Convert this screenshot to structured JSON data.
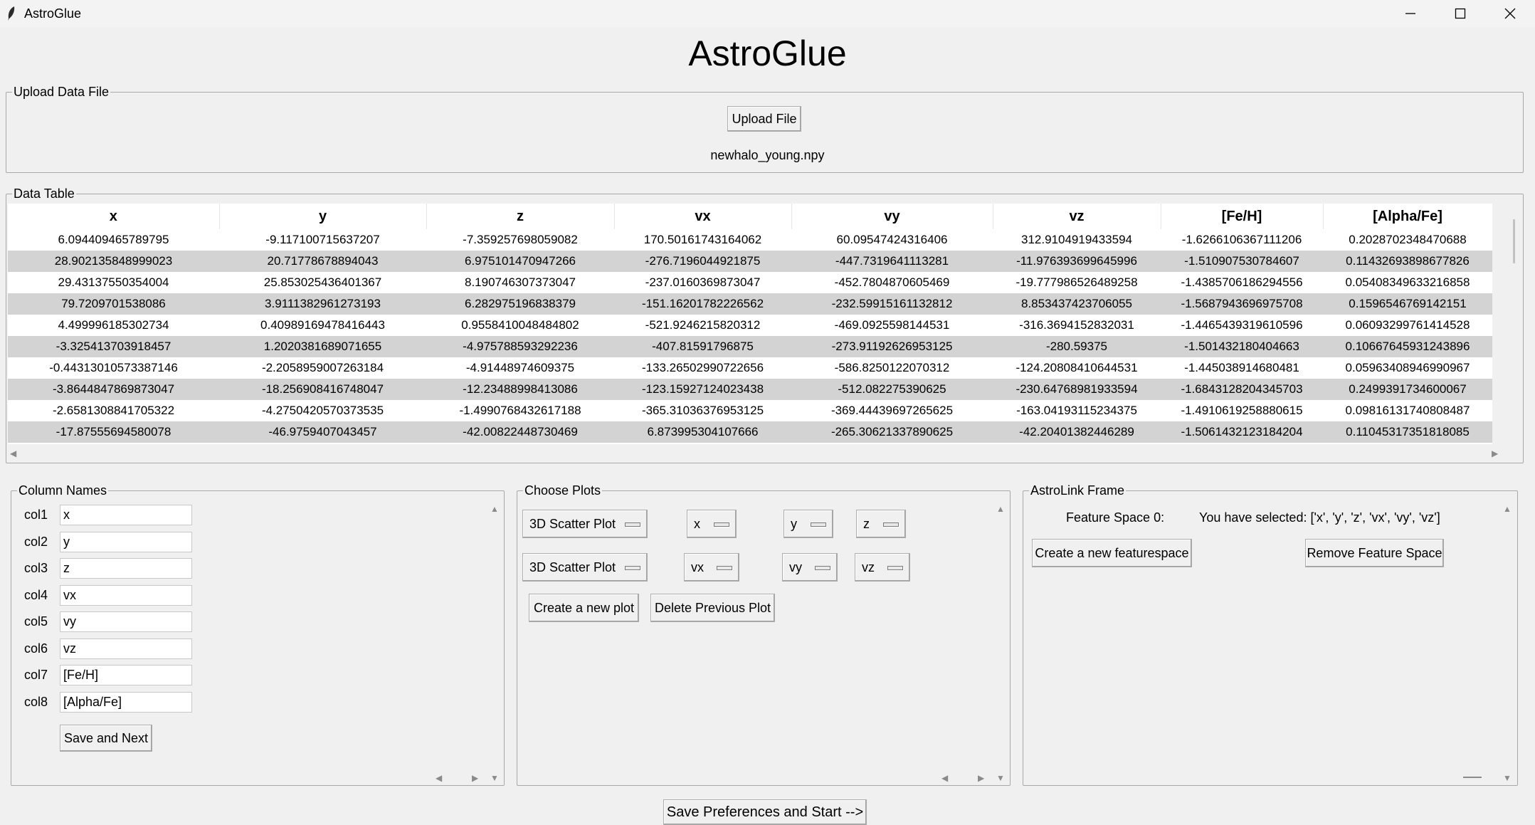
{
  "window": {
    "title": "AstroGlue",
    "minimize_icon": "minimize-icon",
    "maximize_icon": "maximize-icon",
    "close_icon": "close-icon"
  },
  "heading": "AstroGlue",
  "upload": {
    "legend": "Upload Data File",
    "button": "Upload File",
    "filename": "newhalo_young.npy"
  },
  "table": {
    "legend": "Data Table",
    "columns": [
      "x",
      "y",
      "z",
      "vx",
      "vy",
      "vz",
      "[Fe/H]",
      "[Alpha/Fe]"
    ],
    "rows": [
      [
        "6.094409465789795",
        "-9.117100715637207",
        "-7.359257698059082",
        "170.50161743164062",
        "60.09547424316406",
        "312.9104919433594",
        "-1.6266106367111206",
        "0.2028702348470688"
      ],
      [
        "28.902135848999023",
        "20.71778678894043",
        "6.975101470947266",
        "-276.7196044921875",
        "-447.7319641113281",
        "-11.976393699645996",
        "-1.510907530784607",
        "0.11432693898677826"
      ],
      [
        "29.43137550354004",
        "25.853025436401367",
        "8.190746307373047",
        "-237.0160369873047",
        "-452.7804870605469",
        "-19.777986526489258",
        "-1.4385706186294556",
        "0.05408349633216858"
      ],
      [
        "79.7209701538086",
        "3.9111382961273193",
        "6.282975196838379",
        "-151.16201782226562",
        "-232.59915161132812",
        "8.853437423706055",
        "-1.5687943696975708",
        "0.1596546769142151"
      ],
      [
        "4.499996185302734",
        "0.40989169478416443",
        "0.9558410048484802",
        "-521.9246215820312",
        "-469.0925598144531",
        "-316.3694152832031",
        "-1.4465439319610596",
        "0.06093299761414528"
      ],
      [
        "-3.325413703918457",
        "1.2020381689071655",
        "-4.975788593292236",
        "-407.81591796875",
        "-273.91192626953125",
        "-280.59375",
        "-1.501432180404663",
        "0.10667645931243896"
      ],
      [
        "-0.44313010573387146",
        "-2.2058959007263184",
        "-4.91448974609375",
        "-133.26502990722656",
        "-586.8250122070312",
        "-124.20808410644531",
        "-1.445038914680481",
        "0.05963408946990967"
      ],
      [
        "-3.8644847869873047",
        "-18.256908416748047",
        "-12.23488998413086",
        "-123.15927124023438",
        "-512.082275390625",
        "-230.64768981933594",
        "-1.6843128204345703",
        "0.2499391734600067"
      ],
      [
        "-2.6581308841705322",
        "-4.2750420570373535",
        "-1.4990768432617188",
        "-365.31036376953125",
        "-369.44439697265625",
        "-163.04193115234375",
        "-1.4910619258880615",
        "0.09816131740808487"
      ],
      [
        "-17.87555694580078",
        "-46.9759407043457",
        "-42.00822448730469",
        "6.873995304107666",
        "-265.30621337890625",
        "-42.20401382446289",
        "-1.5061432123184204",
        "0.11045317351818085"
      ]
    ]
  },
  "column_names": {
    "legend": "Column Names",
    "items": [
      {
        "label": "col1",
        "value": "x"
      },
      {
        "label": "col2",
        "value": "y"
      },
      {
        "label": "col3",
        "value": "z"
      },
      {
        "label": "col4",
        "value": "vx"
      },
      {
        "label": "col5",
        "value": "vy"
      },
      {
        "label": "col6",
        "value": "vz"
      },
      {
        "label": "col7",
        "value": "[Fe/H]"
      },
      {
        "label": "col8",
        "value": "[Alpha/Fe]"
      }
    ],
    "save_button": "Save and Next"
  },
  "choose_plots": {
    "legend": "Choose Plots",
    "rows": [
      {
        "plot_type": "3D Scatter Plot",
        "x": "x",
        "y": "y",
        "z": "z"
      },
      {
        "plot_type": "3D Scatter Plot",
        "x": "vx",
        "y": "vy",
        "z": "vz"
      }
    ],
    "create_button": "Create a new plot",
    "delete_button": "Delete Previous Plot"
  },
  "astrolink": {
    "legend": "AstroLink Frame",
    "feature_space_label": "Feature Space 0:",
    "selection_text": "You have selected: ['x', 'y', 'z', 'vx', 'vy', 'vz']",
    "create_button": "Create a new featurespace",
    "remove_button": "Remove Feature Space"
  },
  "save_start_button": "Save Preferences and Start -->"
}
